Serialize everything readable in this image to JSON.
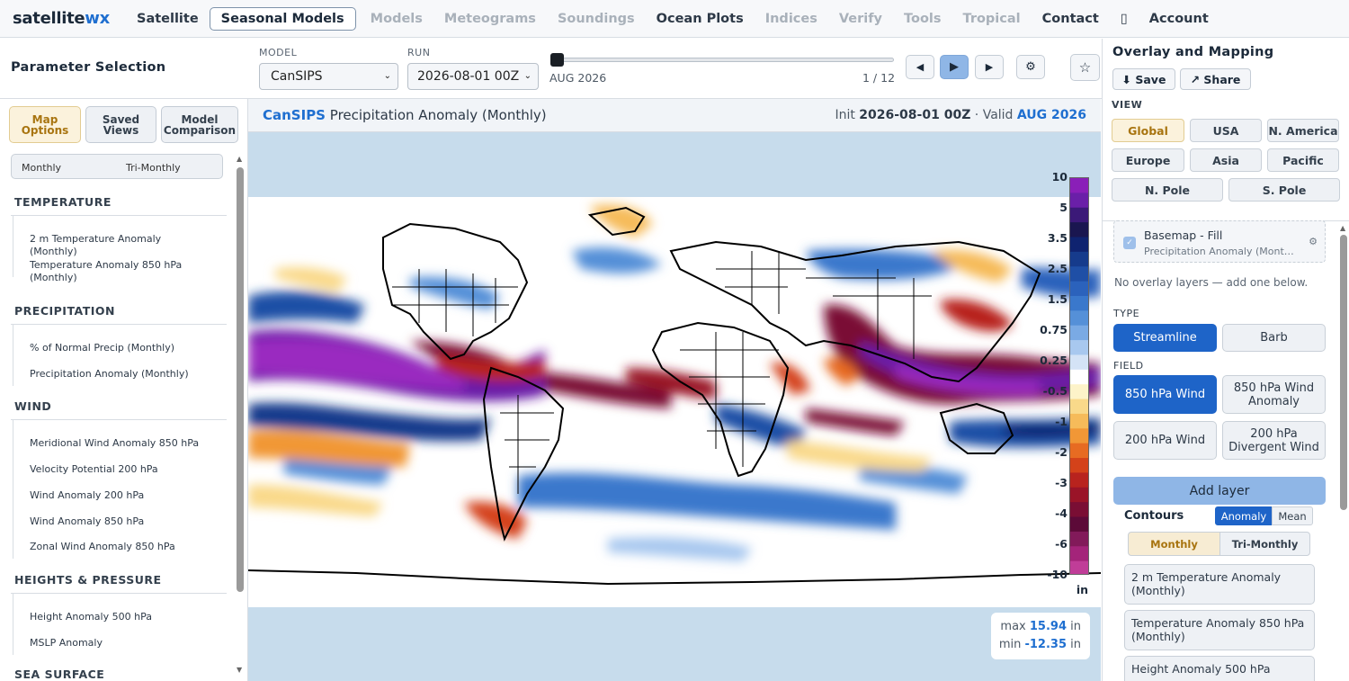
{
  "nav": {
    "brand_main": "satellite",
    "brand_accent": "wx",
    "items": [
      {
        "label": "Satellite",
        "state": "dark"
      },
      {
        "label": "Seasonal Models",
        "state": "active"
      },
      {
        "label": "Models",
        "state": "dim"
      },
      {
        "label": "Meteograms",
        "state": "dim"
      },
      {
        "label": "Soundings",
        "state": "dim"
      },
      {
        "label": "Ocean Plots",
        "state": "dark"
      },
      {
        "label": "Indices",
        "state": "dim"
      },
      {
        "label": "Verify",
        "state": "dim"
      },
      {
        "label": "Tools",
        "state": "dim"
      },
      {
        "label": "Tropical",
        "state": "dim"
      },
      {
        "label": "Contact",
        "state": "dark"
      },
      {
        "label": "▯",
        "state": "dark"
      },
      {
        "label": "Account",
        "state": "dark"
      }
    ]
  },
  "toolbar": {
    "param_title": "Parameter Selection",
    "model_label": "MODEL",
    "model_value": "CanSIPS",
    "run_label": "RUN",
    "run_value": "2026-08-01 00Z",
    "slider_value_label": "AUG 2026",
    "slider_counter": "1 / 12",
    "slider_position": 1,
    "slider_total": 12,
    "prev_icon": "◀",
    "play_icon": "▶",
    "next_icon": "▶",
    "settings_icon": "⚙",
    "star_icon": "☆"
  },
  "left": {
    "tabs": [
      "Map\nOptions",
      "Saved\nViews",
      "Model\nComparison"
    ],
    "period_toggle": [
      "Monthly",
      "Tri-Monthly"
    ],
    "sections": [
      {
        "title": "TEMPERATURE",
        "items": [
          "2 m Temperature Anomaly (Monthly)",
          "Temperature Anomaly 850 hPa (Monthly)"
        ]
      },
      {
        "title": "PRECIPITATION",
        "items": [
          "% of Normal Precip (Monthly)",
          "Precipitation Anomaly (Monthly)"
        ]
      },
      {
        "title": "WIND",
        "items": [
          "Meridional Wind Anomaly 850 hPa",
          "Velocity Potential 200 hPa",
          "Wind Anomaly 200 hPa",
          "Wind Anomaly 850 hPa",
          "Zonal Wind Anomaly 850 hPa"
        ]
      },
      {
        "title": "HEIGHTS & PRESSURE",
        "items": [
          "Height Anomaly 500 hPa",
          "MSLP Anomaly"
        ]
      },
      {
        "title": "SEA SURFACE",
        "items": []
      }
    ]
  },
  "map": {
    "model": "CanSIPS",
    "title": "Precipitation Anomaly (Monthly)",
    "init_label": "Init",
    "init_value": "2026-08-01 00Z",
    "valid_label": "· Valid",
    "valid_value": "AUG 2026",
    "colorbar_labels": [
      "10",
      "5",
      "3.5",
      "2.5",
      "1.5",
      "0.75",
      "0.25",
      "-0.5",
      "-1",
      "-2",
      "-3",
      "-4",
      "-6",
      "-10"
    ],
    "colorbar_unit": "in",
    "colorbar_colors": [
      "#8a1fb8",
      "#6a1fa8",
      "#3b1978",
      "#1a1650",
      "#0f2370",
      "#163b8c",
      "#1f4fa6",
      "#2b62bc",
      "#3a78cc",
      "#5590d8",
      "#7aaae4",
      "#a8c8ef",
      "#d4e3f6",
      "#ffffff",
      "#fdf3c9",
      "#f9d98a",
      "#f6bb5a",
      "#f19736",
      "#e76b22",
      "#d4421a",
      "#b8231e",
      "#9a1428",
      "#7a0e34",
      "#5c0a38",
      "#821a5a",
      "#a4247a",
      "#c03d98"
    ],
    "stats_max_label": "max",
    "stats_max": "15.94",
    "stats_min_label": "min",
    "stats_min": "-12.35",
    "stats_unit": "in"
  },
  "right": {
    "title": "Overlay and Mapping",
    "save_label": "⬇ Save",
    "share_label": "↗ Share",
    "view_label": "VIEW",
    "views_row1": [
      "Global",
      "USA",
      "N. America"
    ],
    "views_row2": [
      "Europe",
      "Asia",
      "Pacific"
    ],
    "views_row3": [
      "N. Pole",
      "S. Pole"
    ],
    "active_view": "Global",
    "basemap_title": "Basemap - Fill",
    "basemap_sub": "Precipitation Anomaly (Mont…",
    "check_icon": "✓",
    "gear_icon": "⚙",
    "no_overlay": "No overlay layers — add one below.",
    "type_label": "TYPE",
    "types": [
      "Streamline",
      "Barb"
    ],
    "field_label": "FIELD",
    "fields": [
      "850 hPa Wind",
      "850 hPa Wind Anomaly",
      "200 hPa Wind",
      "200 hPa Divergent Wind"
    ],
    "add_layer": "Add layer",
    "contours_label": "Contours",
    "contour_modes": [
      "Anomaly",
      "Mean"
    ],
    "contour_periods": [
      "Monthly",
      "Tri-Monthly"
    ],
    "contour_items": [
      "2 m Temperature Anomaly (Monthly)",
      "Temperature Anomaly 850 hPa (Monthly)",
      "Height Anomaly 500 hPa"
    ]
  }
}
